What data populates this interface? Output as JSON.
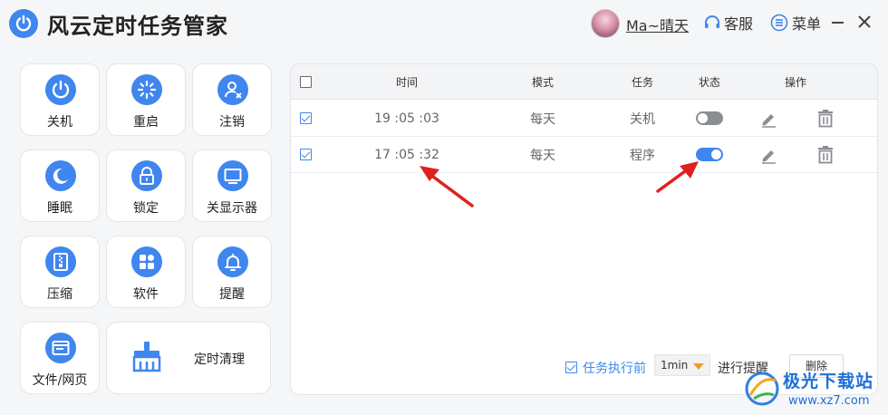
{
  "app": {
    "title": "风云定时任务管家"
  },
  "header": {
    "username": "Ma~晴天",
    "service_label": "客服",
    "menu_label": "菜单"
  },
  "tiles": [
    {
      "label": "关机",
      "icon": "power-icon"
    },
    {
      "label": "重启",
      "icon": "restart-icon"
    },
    {
      "label": "注销",
      "icon": "logout-user-icon"
    },
    {
      "label": "睡眠",
      "icon": "moon-icon"
    },
    {
      "label": "锁定",
      "icon": "lock-icon"
    },
    {
      "label": "关显示器",
      "icon": "monitor-icon"
    },
    {
      "label": "压缩",
      "icon": "zip-file-icon"
    },
    {
      "label": "软件",
      "icon": "apps-icon"
    },
    {
      "label": "提醒",
      "icon": "bell-icon"
    },
    {
      "label": "文件/网页",
      "icon": "webpage-icon"
    },
    {
      "label": "定时清理",
      "icon": "broom-icon"
    }
  ],
  "table": {
    "headers": {
      "time": "时间",
      "mode": "模式",
      "task": "任务",
      "status": "状态",
      "actions": "操作"
    },
    "rows": [
      {
        "checked": true,
        "time": "19 :05 :03",
        "mode": "每天",
        "task": "关机",
        "enabled": false
      },
      {
        "checked": true,
        "time": "17 :05 :32",
        "mode": "每天",
        "task": "程序",
        "enabled": true
      }
    ]
  },
  "footer": {
    "remind_checked": true,
    "remind_label": "任务执行前",
    "interval": "1min",
    "suffix": "进行提醒",
    "delete_label": "删除"
  },
  "watermark": {
    "name": "极光下载站",
    "url": "www.xz7.com"
  },
  "colors": {
    "accent": "#3f86ee",
    "arrow": "#e0201e",
    "caret": "#f59a23"
  }
}
